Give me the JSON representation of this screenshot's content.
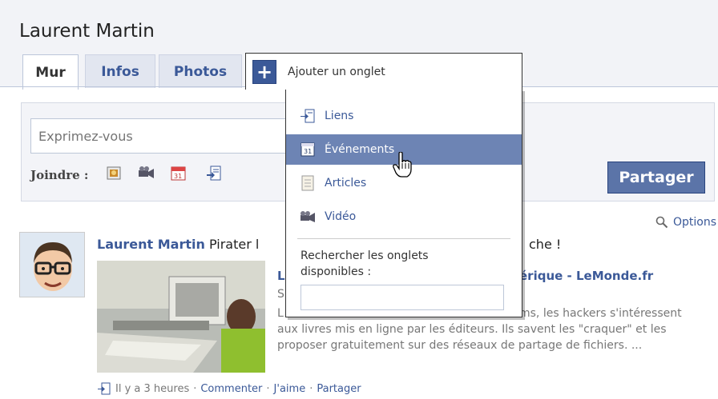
{
  "profile": {
    "name": "Laurent Martin"
  },
  "tabs": [
    {
      "label": "Mur"
    },
    {
      "label": "Infos"
    },
    {
      "label": "Photos"
    }
  ],
  "add_tab": {
    "plus": "+",
    "label": "Ajouter un onglet",
    "menu": [
      {
        "label": "Liens",
        "icon": "link-icon"
      },
      {
        "label": "Événements",
        "icon": "calendar-icon"
      },
      {
        "label": "Articles",
        "icon": "note-icon"
      },
      {
        "label": "Vidéo",
        "icon": "video-icon"
      }
    ],
    "search_label": "Rechercher les onglets disponibles :",
    "search_value": ""
  },
  "composer": {
    "placeholder": "Exprimez-vous",
    "attach_label": "Joindre :",
    "share_label": "Partager"
  },
  "feed": {
    "options_label": "Options",
    "post": {
      "author": "Laurent Martin",
      "text_visible": "Pirater l",
      "text_end": "che !",
      "link_title_left": "L",
      "link_title_right": "érique - LeMonde.fr",
      "source_initial": "S",
      "desc_start": "L",
      "desc_end": "ms, les hackers s'intéressent",
      "desc_line2": "aux livres mis en ligne par les éditeurs. Ils savent les \"craquer\" et les",
      "desc_line3": "proposer gratuitement sur des réseaux de partage de fichiers. ...",
      "time": "Il y a 3 heures",
      "comment_label": "Commenter",
      "like_label": "J'aime",
      "share_label": "Partager",
      "separator": "·"
    }
  },
  "colors": {
    "brand": "#3b5998",
    "highlight": "#6d84b4",
    "share_button": "#5b74a8"
  }
}
